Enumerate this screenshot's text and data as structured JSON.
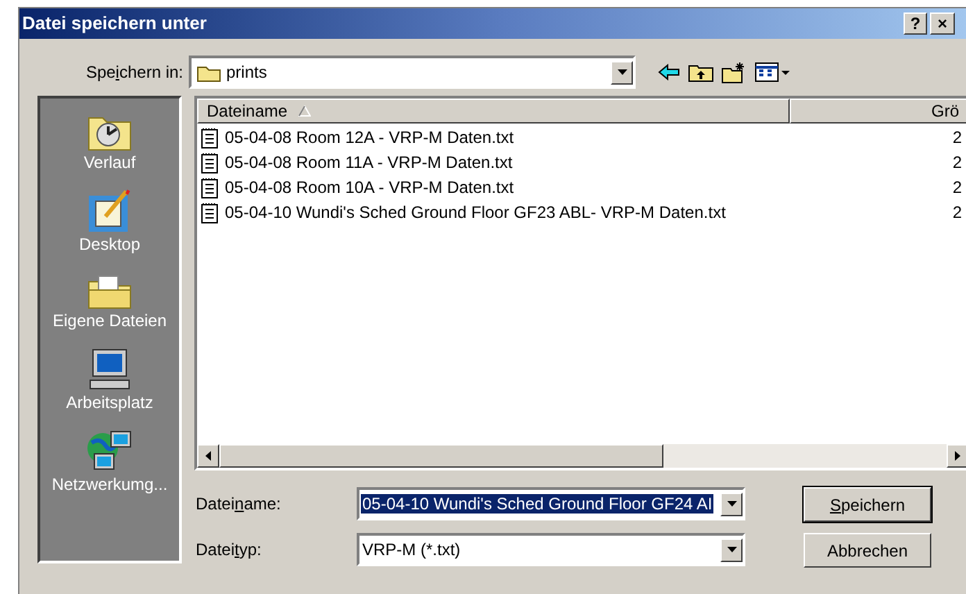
{
  "window": {
    "title": "Datei speichern unter",
    "buttons": [
      {
        "kind": "help",
        "label": "?"
      },
      {
        "kind": "close",
        "label": "×"
      }
    ]
  },
  "save_in": {
    "label": {
      "before": "Spe",
      "key": "i",
      "after": "chern in:"
    },
    "value": "prints"
  },
  "places": [
    {
      "kind": "history",
      "label": "Verlauf"
    },
    {
      "kind": "desktop",
      "label": "Desktop"
    },
    {
      "kind": "documents",
      "label": "Eigene Dateien"
    },
    {
      "kind": "computer",
      "label": "Arbeitsplatz"
    },
    {
      "kind": "network",
      "label": "Netzwerkumg..."
    }
  ],
  "file_list": {
    "columns": [
      {
        "label": "Dateiname",
        "sorted": true
      },
      {
        "label": "Grö",
        "sorted": false
      }
    ],
    "rows": [
      {
        "name": "05-04-08 Room 12A - VRP-M Daten.txt",
        "size": "2"
      },
      {
        "name": "05-04-08 Room 11A - VRP-M Daten.txt",
        "size": "2"
      },
      {
        "name": "05-04-08 Room 10A - VRP-M Daten.txt",
        "size": "2"
      },
      {
        "name": "05-04-10 Wundi's Sched  Ground Floor GF23 ABL- VRP-M Daten.txt",
        "size": "2"
      }
    ]
  },
  "filename": {
    "label": {
      "before": "Datei",
      "key": "n",
      "after": "ame:"
    },
    "value": "05-04-10 Wundi's Sched  Ground Floor GF24 AI",
    "selected": true
  },
  "filetype": {
    "label": {
      "before": "Datei",
      "key": "t",
      "after": "yp:"
    },
    "value": "VRP-M (*.txt)"
  },
  "buttons": [
    {
      "label": {
        "key": "S",
        "after": "peichern"
      },
      "default": true
    },
    {
      "label": {
        "before": "Abbrechen"
      },
      "default": false
    }
  ]
}
